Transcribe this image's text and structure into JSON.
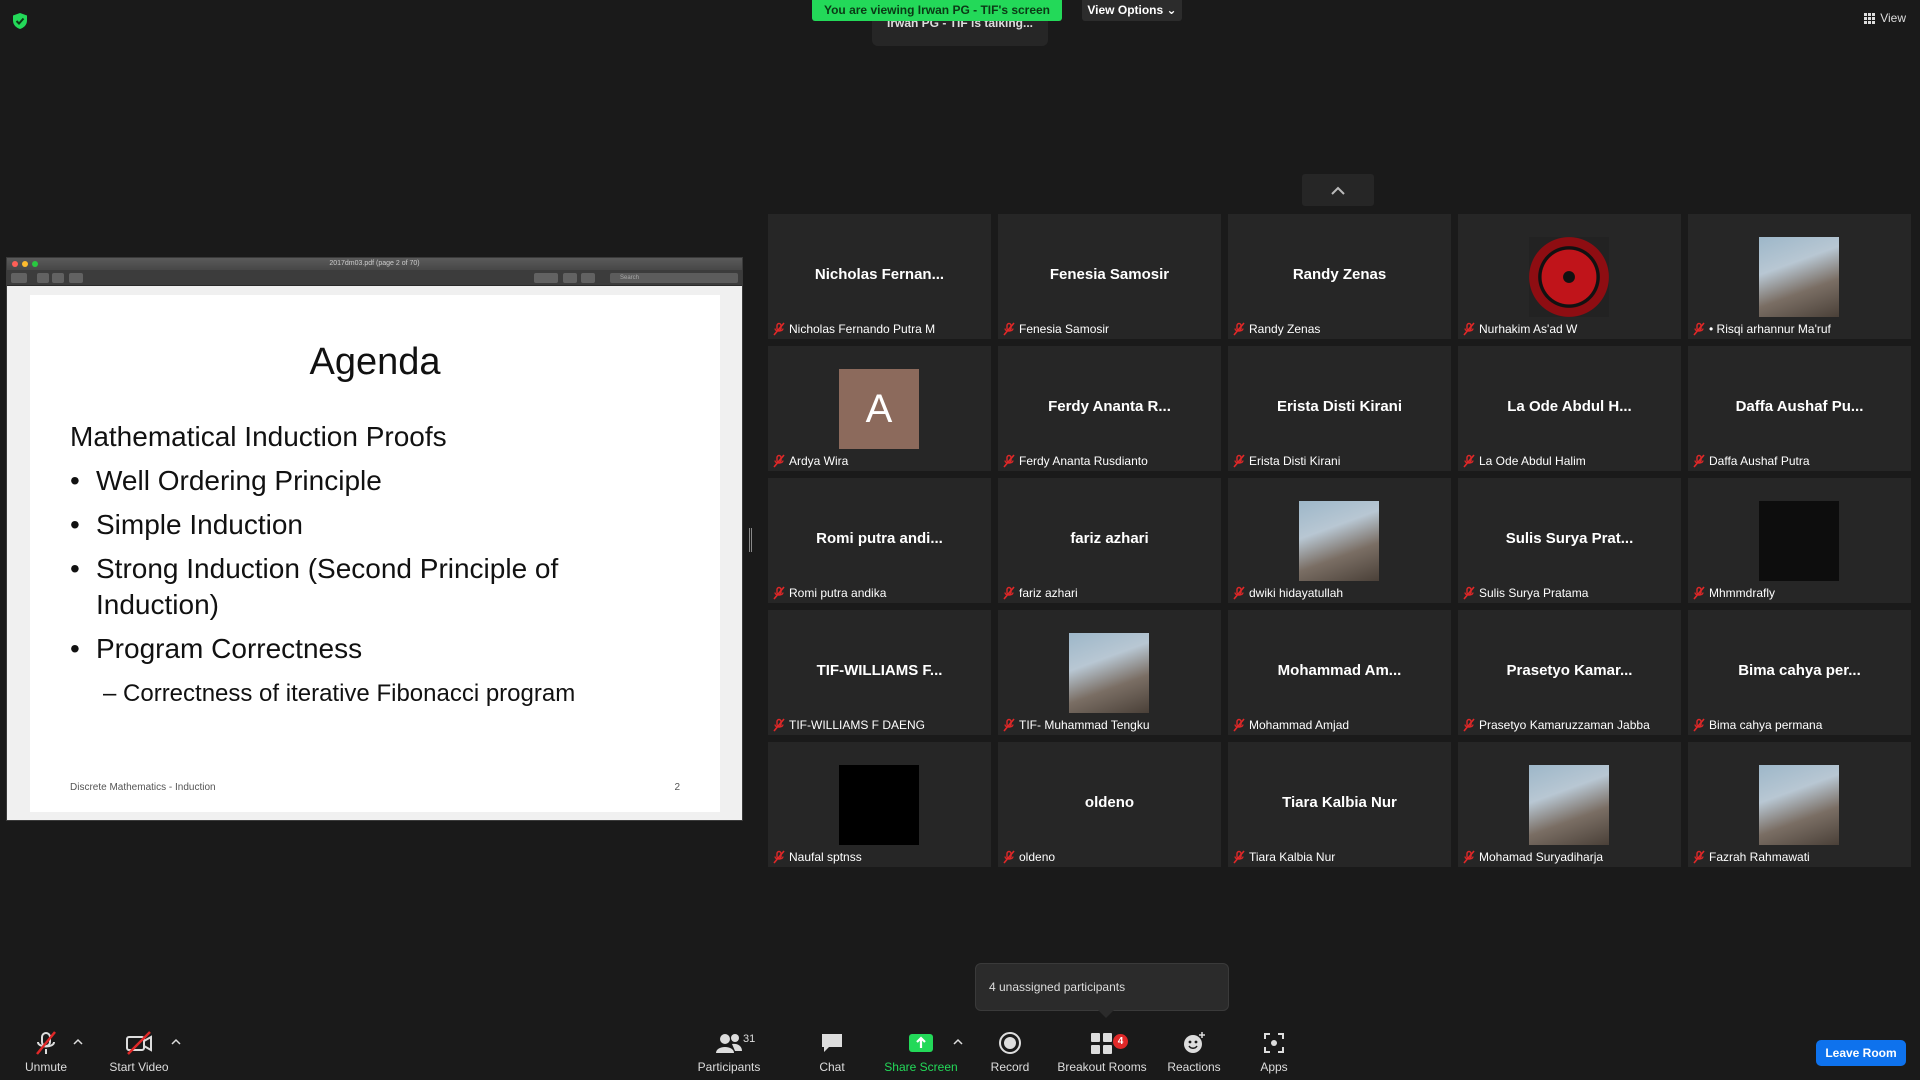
{
  "top_bar": {
    "viewing_banner": "You are viewing Irwan PG - TIF's screen",
    "view_options": "View Options",
    "talking": "Irwan PG - TIF is talking...",
    "view_label": "View"
  },
  "shared_screen": {
    "window_title": "2017dm03.pdf (page 2 of 70)",
    "search_placeholder": "Search",
    "slide": {
      "title": "Agenda",
      "heading": "Mathematical Induction Proofs",
      "bullets": [
        "Well Ordering Principle",
        "Simple Induction",
        "Strong Induction (Second Principle of Induction)",
        "Program Correctness"
      ],
      "sub_bullet": "– Correctness of iterative Fibonacci program",
      "footer": "Discrete Mathematics - Induction",
      "page_number": "2"
    }
  },
  "gallery": {
    "tiles": [
      {
        "big": "Nicholas  Fernan...",
        "label": "Nicholas Fernando Putra M",
        "avatar": null
      },
      {
        "big": "Fenesia Samosir",
        "label": "Fenesia Samosir",
        "avatar": null
      },
      {
        "big": "Randy Zenas",
        "label": "Randy Zenas",
        "avatar": null
      },
      {
        "big": "",
        "label": "Nurhakim As'ad W",
        "avatar": "sharingan-avatar"
      },
      {
        "big": "",
        "label": "• Risqi arhannur Ma'ruf",
        "avatar": "photo-avatar"
      },
      {
        "big": "",
        "label": "Ardya Wira",
        "avatar": "letter-avatar",
        "letter": "A"
      },
      {
        "big": "Ferdy Ananta R...",
        "label": "Ferdy Ananta Rusdianto",
        "avatar": null
      },
      {
        "big": "Erista Disti Kirani",
        "label": "Erista Disti Kirani",
        "avatar": null
      },
      {
        "big": "La Ode Abdul H...",
        "label": "La Ode Abdul Halim",
        "avatar": null
      },
      {
        "big": "Daffa Aushaf Pu...",
        "label": "Daffa Aushaf Putra",
        "avatar": null
      },
      {
        "big": "Romi putra andi...",
        "label": "Romi putra andika",
        "avatar": null
      },
      {
        "big": "fariz azhari",
        "label": "fariz azhari",
        "avatar": null
      },
      {
        "big": "",
        "label": "dwiki hidayatullah",
        "avatar": "photo-avatar"
      },
      {
        "big": "Sulis Surya Prat...",
        "label": "Sulis Surya Pratama",
        "avatar": null
      },
      {
        "big": "",
        "label": "Mhmmdrafly",
        "avatar": "dark-avatar"
      },
      {
        "big": "TIF-WILLIAMS F...",
        "label": "TIF-WILLIAMS F DAENG",
        "avatar": null
      },
      {
        "big": "",
        "label": "TIF- Muhammad Tengku",
        "avatar": "photo-avatar"
      },
      {
        "big": "Mohammad  Am...",
        "label": "Mohammad Amjad",
        "avatar": null
      },
      {
        "big": "Prasetyo  Kamar...",
        "label": "Prasetyo Kamaruzzaman Jabba",
        "avatar": null
      },
      {
        "big": "Bima cahya per...",
        "label": "Bima cahya permana",
        "avatar": null
      },
      {
        "big": "",
        "label": "Naufal sptnss",
        "avatar": "black-avatar"
      },
      {
        "big": "oldeno",
        "label": "oldeno",
        "avatar": null
      },
      {
        "big": "Tiara Kalbia Nur",
        "label": "Tiara Kalbia Nur",
        "avatar": null
      },
      {
        "big": "",
        "label": "Mohamad Suryadiharja",
        "avatar": "photo-avatar"
      },
      {
        "big": "",
        "label": "Fazrah Rahmawati",
        "avatar": "photo-avatar"
      }
    ]
  },
  "popup": {
    "unassigned": "4 unassigned participants"
  },
  "toolbar": {
    "unmute": "Unmute",
    "start_video": "Start Video",
    "participants": "Participants",
    "participants_count": "31",
    "chat": "Chat",
    "share_screen": "Share Screen",
    "record": "Record",
    "breakout_rooms": "Breakout Rooms",
    "breakout_badge": "4",
    "reactions": "Reactions",
    "apps": "Apps",
    "leave_room": "Leave Room"
  },
  "colors": {
    "background": "#1a1a1a",
    "tile": "#262626",
    "banner_green": "#23d959",
    "mute_red": "#e02828",
    "leave_blue": "#0e72ed"
  }
}
